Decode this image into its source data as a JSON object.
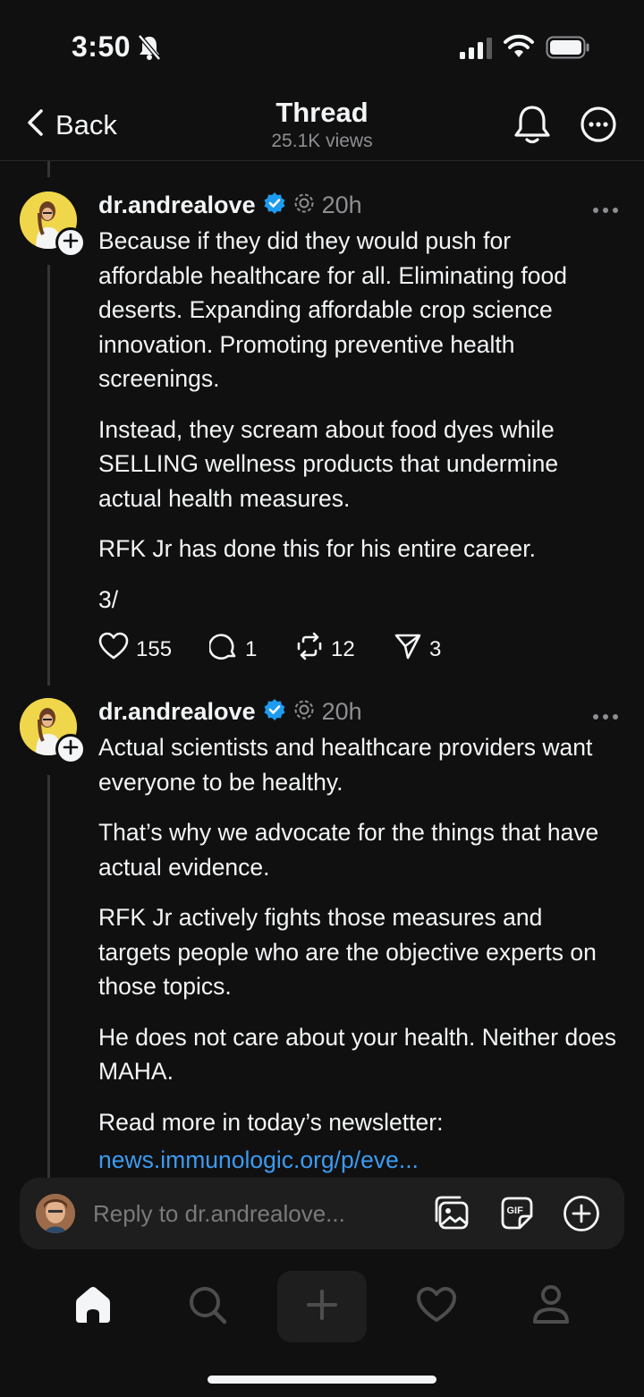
{
  "status_bar": {
    "time": "3:50"
  },
  "header": {
    "back_label": "Back",
    "title": "Thread",
    "views": "25.1K views"
  },
  "posts": [
    {
      "username": "dr.andrealove",
      "time": "20h",
      "paragraphs": [
        "Because if they did they would push for affordable healthcare for all. Eliminating food deserts. Expanding affordable crop science innovation. Promoting preventive health screenings.",
        "Instead, they scream about food dyes while SELLING wellness products that undermine actual health measures.",
        "RFK Jr has done this for his entire career.",
        "3/"
      ],
      "likes": "155",
      "replies": "1",
      "reposts": "12",
      "shares": "3"
    },
    {
      "username": "dr.andrealove",
      "time": "20h",
      "paragraphs": [
        "Actual scientists and healthcare providers want everyone to be healthy.",
        "That’s why we advocate for the things that have actual evidence.",
        "RFK Jr actively fights those measures and targets people who are the objective experts on those topics.",
        "He does not care about your health. Neither does MAHA.",
        "Read more in today’s newsletter:"
      ],
      "link": "news.immunologic.org/p/eve..."
    }
  ],
  "reply_bar": {
    "placeholder": "Reply to dr.andrealove..."
  },
  "colors": {
    "background": "#101010",
    "link": "#3b9bf3",
    "verified": "#1d9bf0",
    "secondary_text": "#8e8e93"
  },
  "icons": {
    "header": [
      "chevron-left-icon",
      "bell-icon",
      "more-horizontal-icon"
    ],
    "post_actions": [
      "heart-icon",
      "comment-icon",
      "repost-icon",
      "send-icon"
    ],
    "reply_bar": [
      "photo-icon",
      "gif-icon",
      "add-circle-icon"
    ],
    "tabs": [
      "home-icon",
      "search-icon",
      "plus-icon",
      "heart-icon",
      "profile-icon"
    ]
  }
}
